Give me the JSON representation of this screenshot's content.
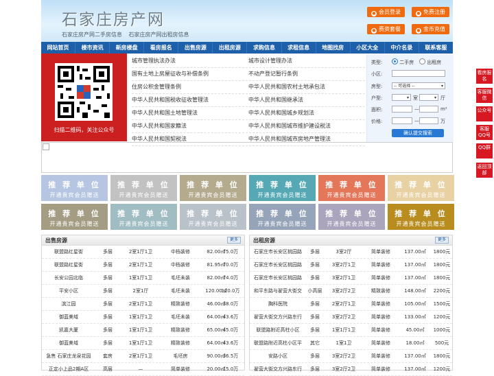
{
  "header": {
    "logo": "石家庄房产网",
    "slogans": [
      "石家庄房产网二手房信息",
      "石家庄房产网出租房信息"
    ],
    "buttons": [
      "会员登录",
      "免费注册",
      "费资套餐",
      "金币充值"
    ]
  },
  "nav": [
    "网站首页",
    "楼市资讯",
    "新房楼盘",
    "看房报名",
    "出售房源",
    "出租房源",
    "求购信息",
    "求租信息",
    "地图找房",
    "小区大全",
    "中介名录",
    "联系客服"
  ],
  "qr": {
    "caption": "扫描二维码，关注公众号"
  },
  "links": [
    [
      "城市管理执法办法",
      "城市设计管理办法"
    ],
    [
      "国有土地上房屋征收与补偿条例",
      "不动产登记暂行条例"
    ],
    [
      "住房公积金管理条例",
      "中华人民共和国农村土地承包法"
    ],
    [
      "中华人民共和国税收征收管理法",
      "中华人民共和国继承法"
    ],
    [
      "中华人民共和国土地管理法",
      "中华人民共和国城乡规划法"
    ],
    [
      "中华人民共和国家籍法",
      "中华人民共和国城市维护建设税法"
    ],
    [
      "中华人民共和国契税法",
      "中华人民共和国城市房地产管理法"
    ]
  ],
  "search": {
    "type_label": "类型:",
    "opt_sale": "二手房",
    "opt_rent": "出租房",
    "community_label": "小区:",
    "house_label": "房型:",
    "house_select": "-- 可选择 --",
    "layout_label": "户型:",
    "room_unit": "室",
    "hall_unit": "厅",
    "area_label": "面积:",
    "area_unit": "m²",
    "price_label": "价格:",
    "price_unit": "万",
    "submit": "确认提交搜索"
  },
  "tiles": {
    "line1": "推 荐 单 位",
    "line2": "开通贵宾会员赠送",
    "colors": [
      "#b6c6e2",
      "#c2c2c2",
      "#b4ab8f",
      "#56a9b4",
      "#e4775a",
      "#e8d2a4",
      "#a49d84",
      "#a0bdc3",
      "#b9c1c9",
      "#96a4ba",
      "#aaa5bc",
      "#b88c1f"
    ]
  },
  "sale": {
    "title": "出售房源",
    "more": "更多",
    "rows": [
      [
        "联盟路红星街",
        "多层",
        "2室1厅1卫",
        "中档装修",
        "82.00㎡",
        "75.0万"
      ],
      [
        "联盟路红星街",
        "多层",
        "2室1厅1卫",
        "中档装修",
        "81.95㎡",
        "70.0万"
      ],
      [
        "长安公园北临",
        "多层",
        "1室1厅1卫",
        "毛坯未装",
        "82.00㎡",
        "74.0万"
      ],
      [
        "平安小区",
        "多层",
        "2室1厅",
        "毛坯未装",
        "120.00㎡",
        "120.0万"
      ],
      [
        "滨江园",
        "多层",
        "2室1厅1卫",
        "精致装修",
        "46.00㎡",
        "38.0万"
      ],
      [
        "御蓝美域",
        "多层",
        "1室1厅1卫",
        "毛坯未装",
        "64.00㎡",
        "43.6万"
      ],
      [
        "凯嘉大厦",
        "多层",
        "1室1厅1卫",
        "精致装修",
        "65.00㎡",
        "45.0万"
      ],
      [
        "御蓝美域",
        "多层",
        "1室1厅1卫",
        "精致装修",
        "64.00㎡",
        "43.6万"
      ],
      [
        "急售 石家庄龙泉花园",
        "套房",
        "2室1厅1卫",
        "毛坯房",
        "90.00㎡",
        "36.5万"
      ],
      [
        "正定小上品2期A区",
        "高层",
        "—",
        "简单装修",
        "20.00㎡",
        "15.0万"
      ]
    ]
  },
  "rent": {
    "title": "出租房源",
    "more": "更多",
    "rows": [
      [
        "石家庄市长安区桃园路",
        "多层",
        "3室2厅",
        "简单装修",
        "137.00㎡",
        "1800元"
      ],
      [
        "石家庄市长安区桃园路",
        "多层",
        "3室2厅1卫",
        "简单装修",
        "137.00㎡",
        "1800元"
      ],
      [
        "石家庄市长安区桃园路",
        "多层",
        "3室2厅1卫",
        "简单装修",
        "137.00㎡",
        "1800元"
      ],
      [
        "和平东路与翟营大街交",
        "小高层",
        "3室2厅2卫",
        "精致装修",
        "148.00㎡",
        "2200元"
      ],
      [
        "胸科医院",
        "多层",
        "2室2厅1卫",
        "简单装修",
        "105.00㎡",
        "1500元"
      ],
      [
        "翟营大街交方兴路东行",
        "多层",
        "3室2厅2卫",
        "简单装修",
        "133.00㎡",
        "1200元"
      ],
      [
        "联盟路附近高柱小区",
        "多层",
        "1室1厅1卫",
        "简单装修",
        "45.00㎡",
        "1000元"
      ],
      [
        "联盟路附近高柱小区平",
        "其它",
        "1室1卫",
        "简单装修",
        "18.00㎡",
        "500元"
      ],
      [
        "安路小区",
        "多层",
        "3室2厅2卫",
        "简单装修",
        "137.00㎡",
        "1800元"
      ],
      [
        "翟营大街交方兴路东行",
        "多层",
        "3室2厅2卫",
        "简单装修",
        "137.00㎡",
        "1200元"
      ]
    ]
  },
  "float": [
    "看房报名",
    "客服微信",
    "公众号",
    "客服QQ号",
    "QQ群",
    "返回顶部"
  ]
}
